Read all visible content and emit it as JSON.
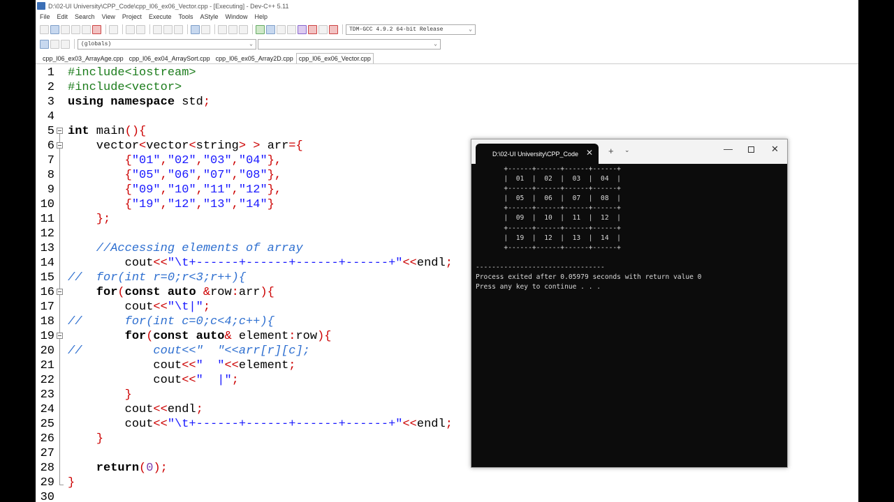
{
  "window": {
    "title": "D:\\02-UI University\\CPP_Code\\cpp_l06_ex06_Vector.cpp - [Executing] - Dev-C++ 5.11"
  },
  "menu": [
    "File",
    "Edit",
    "Search",
    "View",
    "Project",
    "Execute",
    "Tools",
    "AStyle",
    "Window",
    "Help"
  ],
  "toolbar": {
    "compiler": "TDM-GCC 4.9.2 64-bit Release",
    "scope": "(globals)"
  },
  "tabs": [
    {
      "label": "cpp_l06_ex03_ArrayAge.cpp",
      "active": false
    },
    {
      "label": "cpp_l06_ex04_ArraySort.cpp",
      "active": false
    },
    {
      "label": "cpp_l06_ex05_Array2D.cpp",
      "active": false
    },
    {
      "label": "cpp_l06_ex06_Vector.cpp",
      "active": true
    }
  ],
  "code": [
    {
      "n": "1",
      "tokens": [
        [
          "pp",
          "#include<iostream>"
        ]
      ]
    },
    {
      "n": "2",
      "tokens": [
        [
          "pp",
          "#include<vector>"
        ]
      ]
    },
    {
      "n": "3",
      "tokens": [
        [
          "kw",
          "using namespace"
        ],
        [
          "id",
          " std"
        ],
        [
          "sym",
          ";"
        ]
      ]
    },
    {
      "n": "4",
      "tokens": []
    },
    {
      "n": "5",
      "fold": true,
      "tokens": [
        [
          "kw",
          "int"
        ],
        [
          "id",
          " main"
        ],
        [
          "sym",
          "(){"
        ]
      ]
    },
    {
      "n": "6",
      "fold": true,
      "tokens": [
        [
          "id",
          "    vector"
        ],
        [
          "sym",
          "<"
        ],
        [
          "id",
          "vector"
        ],
        [
          "sym",
          "<"
        ],
        [
          "id",
          "string"
        ],
        [
          "sym",
          "> > "
        ],
        [
          "id",
          "arr"
        ],
        [
          "sym",
          "={"
        ]
      ]
    },
    {
      "n": "7",
      "tokens": [
        [
          "id",
          "        "
        ],
        [
          "sym",
          "{"
        ],
        [
          "str",
          "\"01\""
        ],
        [
          "sym",
          ","
        ],
        [
          "str",
          "\"02\""
        ],
        [
          "sym",
          ","
        ],
        [
          "str",
          "\"03\""
        ],
        [
          "sym",
          ","
        ],
        [
          "str",
          "\"04\""
        ],
        [
          "sym",
          "},"
        ]
      ]
    },
    {
      "n": "8",
      "tokens": [
        [
          "id",
          "        "
        ],
        [
          "sym",
          "{"
        ],
        [
          "str",
          "\"05\""
        ],
        [
          "sym",
          ","
        ],
        [
          "str",
          "\"06\""
        ],
        [
          "sym",
          ","
        ],
        [
          "str",
          "\"07\""
        ],
        [
          "sym",
          ","
        ],
        [
          "str",
          "\"08\""
        ],
        [
          "sym",
          "},"
        ]
      ]
    },
    {
      "n": "9",
      "tokens": [
        [
          "id",
          "        "
        ],
        [
          "sym",
          "{"
        ],
        [
          "str",
          "\"09\""
        ],
        [
          "sym",
          ","
        ],
        [
          "str",
          "\"10\""
        ],
        [
          "sym",
          ","
        ],
        [
          "str",
          "\"11\""
        ],
        [
          "sym",
          ","
        ],
        [
          "str",
          "\"12\""
        ],
        [
          "sym",
          "},"
        ]
      ]
    },
    {
      "n": "10",
      "tokens": [
        [
          "id",
          "        "
        ],
        [
          "sym",
          "{"
        ],
        [
          "str",
          "\"19\""
        ],
        [
          "sym",
          ","
        ],
        [
          "str",
          "\"12\""
        ],
        [
          "sym",
          ","
        ],
        [
          "str",
          "\"13\""
        ],
        [
          "sym",
          ","
        ],
        [
          "str",
          "\"14\""
        ],
        [
          "sym",
          "}"
        ]
      ]
    },
    {
      "n": "11",
      "tokens": [
        [
          "id",
          "    "
        ],
        [
          "sym",
          "};"
        ]
      ]
    },
    {
      "n": "12",
      "tokens": []
    },
    {
      "n": "13",
      "tokens": [
        [
          "cmt",
          "    //Accessing elements of array"
        ]
      ]
    },
    {
      "n": "14",
      "tokens": [
        [
          "id",
          "        cout"
        ],
        [
          "sym",
          "<<"
        ],
        [
          "str",
          "\"\\t+------+------+------+------+\""
        ],
        [
          "sym",
          "<<"
        ],
        [
          "id",
          "endl"
        ],
        [
          "sym",
          ";"
        ]
      ]
    },
    {
      "n": "15",
      "tokens": [
        [
          "cmt",
          "//  for(int r=0;r<3;r++){"
        ]
      ]
    },
    {
      "n": "16",
      "fold": true,
      "tokens": [
        [
          "kw",
          "    for"
        ],
        [
          "sym",
          "("
        ],
        [
          "kw",
          "const auto"
        ],
        [
          "id",
          " "
        ],
        [
          "sym",
          "&"
        ],
        [
          "id",
          "row"
        ],
        [
          "sym",
          ":"
        ],
        [
          "id",
          "arr"
        ],
        [
          "sym",
          "){"
        ]
      ]
    },
    {
      "n": "17",
      "tokens": [
        [
          "id",
          "        cout"
        ],
        [
          "sym",
          "<<"
        ],
        [
          "str",
          "\"\\t|\""
        ],
        [
          "sym",
          ";"
        ]
      ]
    },
    {
      "n": "18",
      "tokens": [
        [
          "cmt",
          "//      for(int c=0;c<4;c++){"
        ]
      ]
    },
    {
      "n": "19",
      "fold": true,
      "tokens": [
        [
          "kw",
          "        for"
        ],
        [
          "sym",
          "("
        ],
        [
          "kw",
          "const auto"
        ],
        [
          "sym",
          "&"
        ],
        [
          "id",
          " element"
        ],
        [
          "sym",
          ":"
        ],
        [
          "id",
          "row"
        ],
        [
          "sym",
          "){"
        ]
      ]
    },
    {
      "n": "20",
      "tokens": [
        [
          "cmt",
          "//          cout<<\"  \"<<arr[r][c];"
        ]
      ]
    },
    {
      "n": "21",
      "tokens": [
        [
          "id",
          "            cout"
        ],
        [
          "sym",
          "<<"
        ],
        [
          "str",
          "\"  \""
        ],
        [
          "sym",
          "<<"
        ],
        [
          "id",
          "element"
        ],
        [
          "sym",
          ";"
        ]
      ]
    },
    {
      "n": "22",
      "tokens": [
        [
          "id",
          "            cout"
        ],
        [
          "sym",
          "<<"
        ],
        [
          "str",
          "\"  |\""
        ],
        [
          "sym",
          ";"
        ]
      ]
    },
    {
      "n": "23",
      "tokens": [
        [
          "id",
          "        "
        ],
        [
          "sym",
          "}"
        ]
      ]
    },
    {
      "n": "24",
      "tokens": [
        [
          "id",
          "        cout"
        ],
        [
          "sym",
          "<<"
        ],
        [
          "id",
          "endl"
        ],
        [
          "sym",
          ";"
        ]
      ]
    },
    {
      "n": "25",
      "tokens": [
        [
          "id",
          "        cout"
        ],
        [
          "sym",
          "<<"
        ],
        [
          "str",
          "\"\\t+------+------+------+------+\""
        ],
        [
          "sym",
          "<<"
        ],
        [
          "id",
          "endl"
        ],
        [
          "sym",
          ";"
        ]
      ]
    },
    {
      "n": "26",
      "tokens": [
        [
          "id",
          "    "
        ],
        [
          "sym",
          "}"
        ]
      ]
    },
    {
      "n": "27",
      "tokens": []
    },
    {
      "n": "28",
      "tokens": [
        [
          "kw",
          "    return"
        ],
        [
          "sym",
          "("
        ],
        [
          "num",
          "0"
        ],
        [
          "sym",
          ");"
        ]
      ]
    },
    {
      "n": "29",
      "foldend": true,
      "tokens": [
        [
          "sym",
          "}"
        ]
      ]
    },
    {
      "n": "30",
      "tokens": []
    }
  ],
  "console": {
    "tab_title": "D:\\02-UI University\\CPP_Code",
    "lines": [
      "       +------+------+------+------+",
      "       |  01  |  02  |  03  |  04  |",
      "       +------+------+------+------+",
      "       |  05  |  06  |  07  |  08  |",
      "       +------+------+------+------+",
      "       |  09  |  10  |  11  |  12  |",
      "       +------+------+------+------+",
      "       |  19  |  12  |  13  |  14  |",
      "       +------+------+------+------+",
      "",
      "--------------------------------",
      "Process exited after 0.05979 seconds with return value 0",
      "Press any key to continue . . ."
    ]
  },
  "colors": {
    "preprocessor": "#1d7d1d",
    "keyword": "#000000",
    "symbol": "#cc0000",
    "string": "#1a1aff",
    "comment": "#2e6fd0",
    "number": "#7a3fb0",
    "console_bg": "#0c0c0c"
  }
}
